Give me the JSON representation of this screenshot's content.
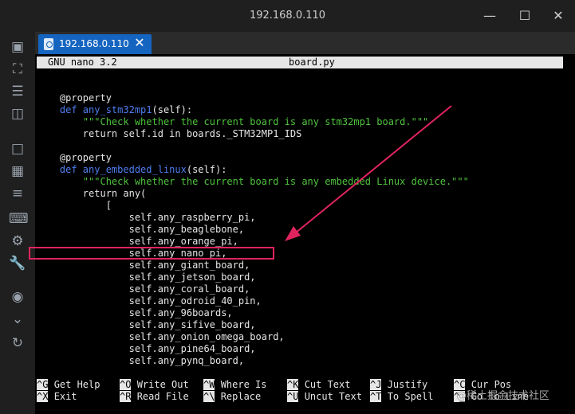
{
  "window": {
    "title": "192.168.0.110",
    "minimize_icon": "minimize-icon",
    "maximize_icon": "maximize-icon",
    "close_icon": "close-icon"
  },
  "tab": {
    "label": "192.168.0.110",
    "icon": "session-icon"
  },
  "sidebar": {
    "icons": [
      "terminal-icon",
      "fullscreen-icon",
      "menu-lines-icon",
      "split-view-icon",
      "crop-icon",
      "tiles-icon",
      "list-icon",
      "keyboard-icon",
      "settings-icon",
      "wrench-icon",
      "camera-icon",
      "chevron-down-icon",
      "reconnect-icon"
    ]
  },
  "editor": {
    "app": "GNU nano 3.2",
    "filename": "board.py",
    "lines": [
      {
        "segments": [
          {
            "text": "    @property",
            "style": "white"
          }
        ]
      },
      {
        "segments": [
          {
            "text": "    def ",
            "style": "kw"
          },
          {
            "text": "any_stm32mp1",
            "style": "kw"
          },
          {
            "text": "(self):",
            "style": "white"
          }
        ]
      },
      {
        "segments": [
          {
            "text": "        \"\"\"Check whether the current board is any stm32mp1 board.\"\"\"",
            "style": "str"
          }
        ]
      },
      {
        "segments": [
          {
            "text": "        return self.id in boards._STM32MP1_IDS",
            "style": "white"
          }
        ]
      },
      {
        "segments": [
          {
            "text": "",
            "style": "white"
          }
        ]
      },
      {
        "segments": [
          {
            "text": "    @property",
            "style": "white"
          }
        ]
      },
      {
        "segments": [
          {
            "text": "    def ",
            "style": "kw"
          },
          {
            "text": "any_embedded_linux",
            "style": "kw"
          },
          {
            "text": "(self):",
            "style": "white"
          }
        ]
      },
      {
        "segments": [
          {
            "text": "        \"\"\"Check whether the current board is any embedded Linux device.\"\"\"",
            "style": "str"
          }
        ]
      },
      {
        "segments": [
          {
            "text": "        return any(",
            "style": "white"
          }
        ]
      },
      {
        "segments": [
          {
            "text": "            [",
            "style": "white"
          }
        ]
      },
      {
        "segments": [
          {
            "text": "                self.any_raspberry_pi,",
            "style": "white"
          }
        ]
      },
      {
        "segments": [
          {
            "text": "                self.any_beaglebone,",
            "style": "white"
          }
        ]
      },
      {
        "segments": [
          {
            "text": "                self.any_orange_pi,",
            "style": "white"
          }
        ]
      },
      {
        "segments": [
          {
            "text": "                self.any_nano_pi,",
            "style": "white"
          }
        ]
      },
      {
        "segments": [
          {
            "text": "                self.any_giant_board,",
            "style": "white"
          }
        ]
      },
      {
        "segments": [
          {
            "text": "                self.any_jetson_board,",
            "style": "white"
          }
        ]
      },
      {
        "segments": [
          {
            "text": "                self.any_coral_board,",
            "style": "white"
          }
        ]
      },
      {
        "segments": [
          {
            "text": "                self.any_odroid_40_pin,",
            "style": "white"
          }
        ]
      },
      {
        "segments": [
          {
            "text": "                self.any_96boards,",
            "style": "white"
          }
        ]
      },
      {
        "segments": [
          {
            "text": "                self.any_sifive_board,",
            "style": "white"
          }
        ]
      },
      {
        "segments": [
          {
            "text": "                self.any_onion_omega_board,",
            "style": "white"
          }
        ]
      },
      {
        "segments": [
          {
            "text": "                self.any_pine64_board,",
            "style": "white"
          }
        ]
      },
      {
        "segments": [
          {
            "text": "                self.any_pynq_board,",
            "style": "white"
          }
        ]
      }
    ],
    "shortcuts": [
      {
        "key": "^G",
        "label": "Get Help"
      },
      {
        "key": "^X",
        "label": "Exit"
      },
      {
        "key": "^O",
        "label": "Write Out"
      },
      {
        "key": "^R",
        "label": "Read File"
      },
      {
        "key": "^W",
        "label": "Where Is"
      },
      {
        "key": "^\\",
        "label": "Replace"
      },
      {
        "key": "^K",
        "label": "Cut Text"
      },
      {
        "key": "^U",
        "label": "Uncut Text"
      },
      {
        "key": "^J",
        "label": "Justify"
      },
      {
        "key": "^T",
        "label": "To Spell"
      },
      {
        "key": "^C",
        "label": "Cur Pos"
      },
      {
        "key": "^_",
        "label": "Go To Line"
      }
    ]
  },
  "colors": {
    "accent": "#1565c0",
    "annotation": "#e0245e",
    "keyword": "#4f7df0",
    "string": "#4ec23c"
  },
  "watermark": "@稀土掘金技术社区"
}
